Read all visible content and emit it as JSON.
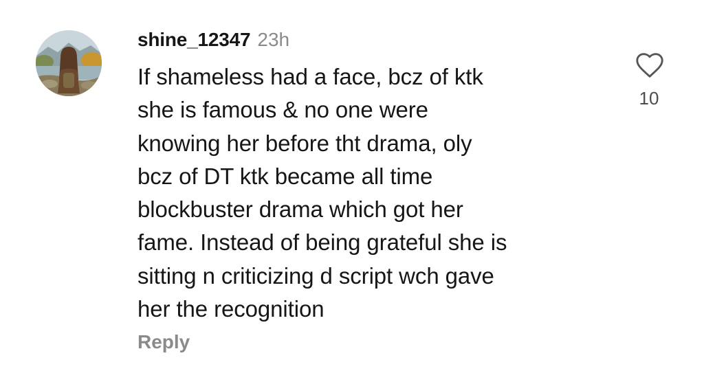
{
  "comment": {
    "username": "shine_12347",
    "timestamp": "23h",
    "text": "If shameless had a face, bcz of ktk\nshe is famous & no one were\nknowing her before tht drama, oly\nbcz of DT ktk became all time\nblockbuster drama which got her\nfame. Instead of being grateful she is\nsitting n criticizing d script wch gave\nher the recognition",
    "reply_label": "Reply",
    "like_count": "10",
    "icons": {
      "avatar": "profile-photo",
      "like": "heart-outline-icon"
    },
    "colors": {
      "primary_text": "#161616",
      "secondary_text": "#8a8a8a",
      "like_icon": "#555555"
    }
  }
}
